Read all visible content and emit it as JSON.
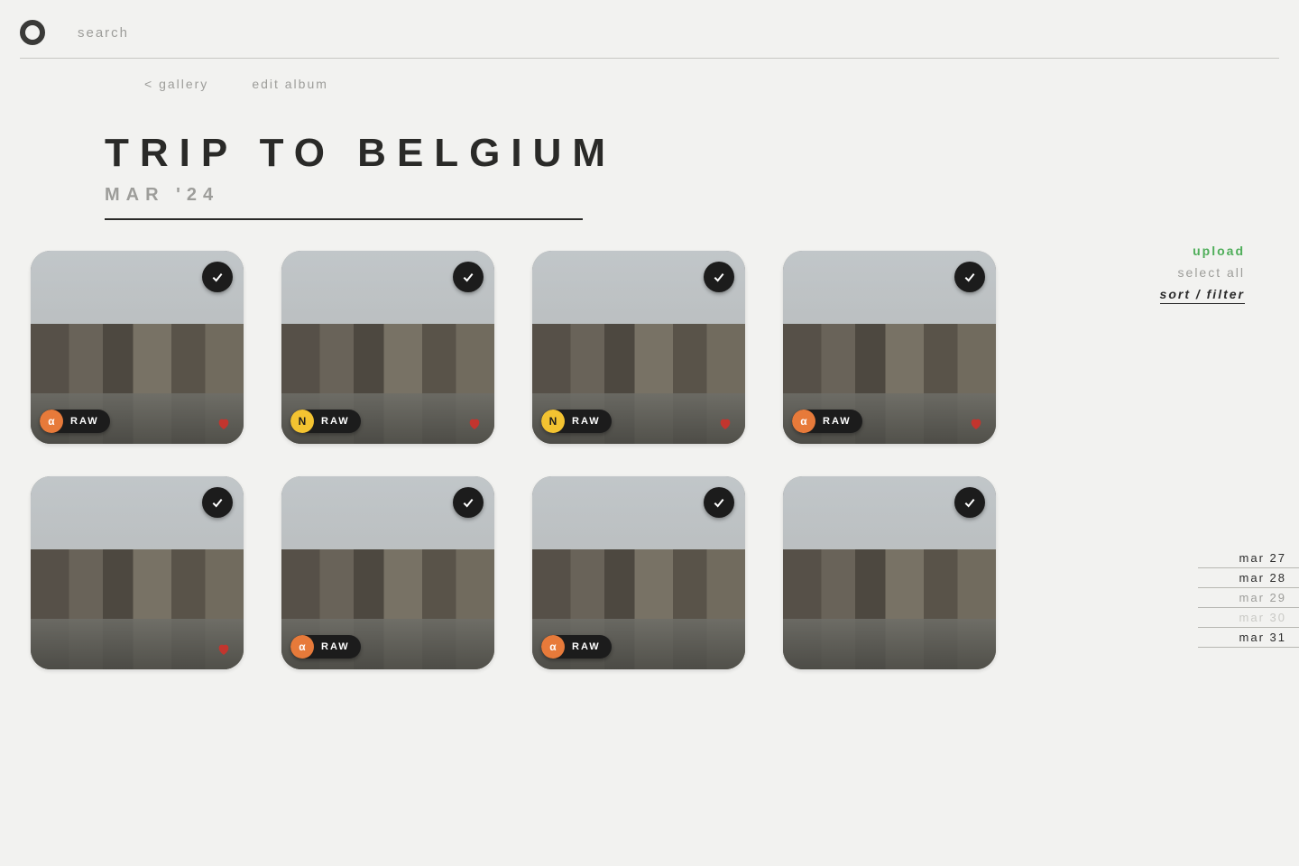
{
  "top": {
    "search": "search"
  },
  "nav": {
    "back": "< gallery",
    "edit": "edit album"
  },
  "title": {
    "heading": "TRIP TO BELGIUM",
    "date": "MAR '24"
  },
  "actions": {
    "upload": "upload",
    "select_all": "select all",
    "sort_filter": "sort / filter"
  },
  "raw_label": "RAW",
  "icon_letters": {
    "orange": "α",
    "yellow": "N"
  },
  "thumbs": [
    {
      "pill": "orange",
      "heart": true
    },
    {
      "pill": "yellow",
      "heart": true
    },
    {
      "pill": "yellow",
      "heart": true
    },
    {
      "pill": "orange",
      "heart": true
    },
    {
      "pill": null,
      "heart": true
    },
    {
      "pill": "orange",
      "heart": false
    },
    {
      "pill": "orange",
      "heart": false
    },
    {
      "pill": null,
      "heart": false
    }
  ],
  "dates": [
    {
      "label": "mar 27",
      "style": "normal"
    },
    {
      "label": "mar 28",
      "style": "normal"
    },
    {
      "label": "mar 29",
      "style": "faded"
    },
    {
      "label": "mar 30",
      "style": "faded2"
    },
    {
      "label": "mar 31",
      "style": "normal"
    }
  ]
}
